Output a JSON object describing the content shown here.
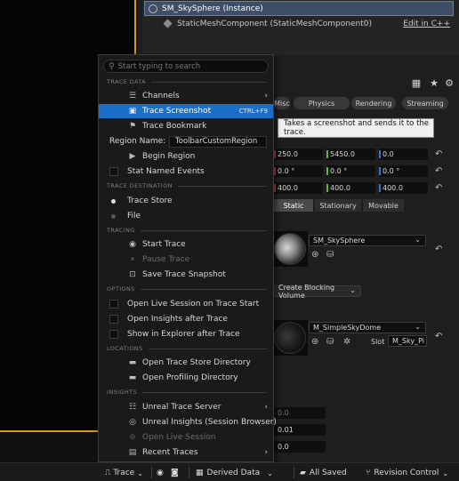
{
  "outliner": {
    "actor_label": "SM_SkySphere (Instance)",
    "component_label": "StaticMeshComponent (StaticMeshComponent0)",
    "edit_link": "Edit in C++"
  },
  "details": {
    "categories": [
      "Misc",
      "Physics",
      "Rendering",
      "Streaming"
    ],
    "tooltip": "Takes a screenshot and sends it to the trace.",
    "location": [
      "250.0",
      "5450.0",
      "0.0"
    ],
    "rotation": [
      "0.0 °",
      "0.0 °",
      "0.0 °"
    ],
    "scale": [
      "400.0",
      "400.0",
      "400.0"
    ],
    "mobility": [
      "Static",
      "Stationary",
      "Movable"
    ],
    "static_mesh": "SM_SkySphere",
    "collision_button": "Create Blocking Volume",
    "material": "M_SimpleSkyDome",
    "slot_label": "Slot",
    "slot_value": "M_Sky_Pi",
    "lower_values": [
      "0.0",
      "0.01",
      "0.0"
    ]
  },
  "trace_menu": {
    "search_placeholder": "Start typing to search",
    "sections": {
      "trace_data": "TRACE DATA",
      "trace_destination": "TRACE DESTINATION",
      "tracing": "TRACING",
      "options": "OPTIONS",
      "locations": "LOCATIONS",
      "insights": "INSIGHTS"
    },
    "items": {
      "channels": "Channels",
      "trace_screenshot": "Trace Screenshot",
      "trace_screenshot_shortcut": "CTRL+F9",
      "trace_bookmark": "Trace Bookmark",
      "region_name_label": "Region Name:",
      "region_name_value": "ToolbarCustomRegion",
      "begin_region": "Begin Region",
      "stat_named_events": "Stat Named Events",
      "trace_store": "Trace Store",
      "file": "File",
      "start_trace": "Start Trace",
      "pause_trace": "Pause Trace",
      "save_trace_snapshot": "Save Trace Snapshot",
      "open_live_session_on_start": "Open Live Session on Trace Start",
      "open_insights_after_trace": "Open Insights after Trace",
      "show_in_explorer_after_trace": "Show in Explorer after Trace",
      "open_trace_store_directory": "Open Trace Store Directory",
      "open_profiling_directory": "Open Profiling Directory",
      "unreal_trace_server": "Unreal Trace Server",
      "unreal_insights": "Unreal Insights (Session Browser)",
      "open_live_session": "Open Live Session",
      "recent_traces": "Recent Traces"
    }
  },
  "status_bar": {
    "trace": "Trace",
    "derived_data": "Derived Data",
    "all_saved": "All Saved",
    "revision_control": "Revision Control"
  },
  "colors": {
    "highlight": "#1a6fc7",
    "viewport_border": "#d99a13",
    "axis_x": "#c83838",
    "axis_y": "#5fb336",
    "axis_z": "#3a6fd6"
  }
}
